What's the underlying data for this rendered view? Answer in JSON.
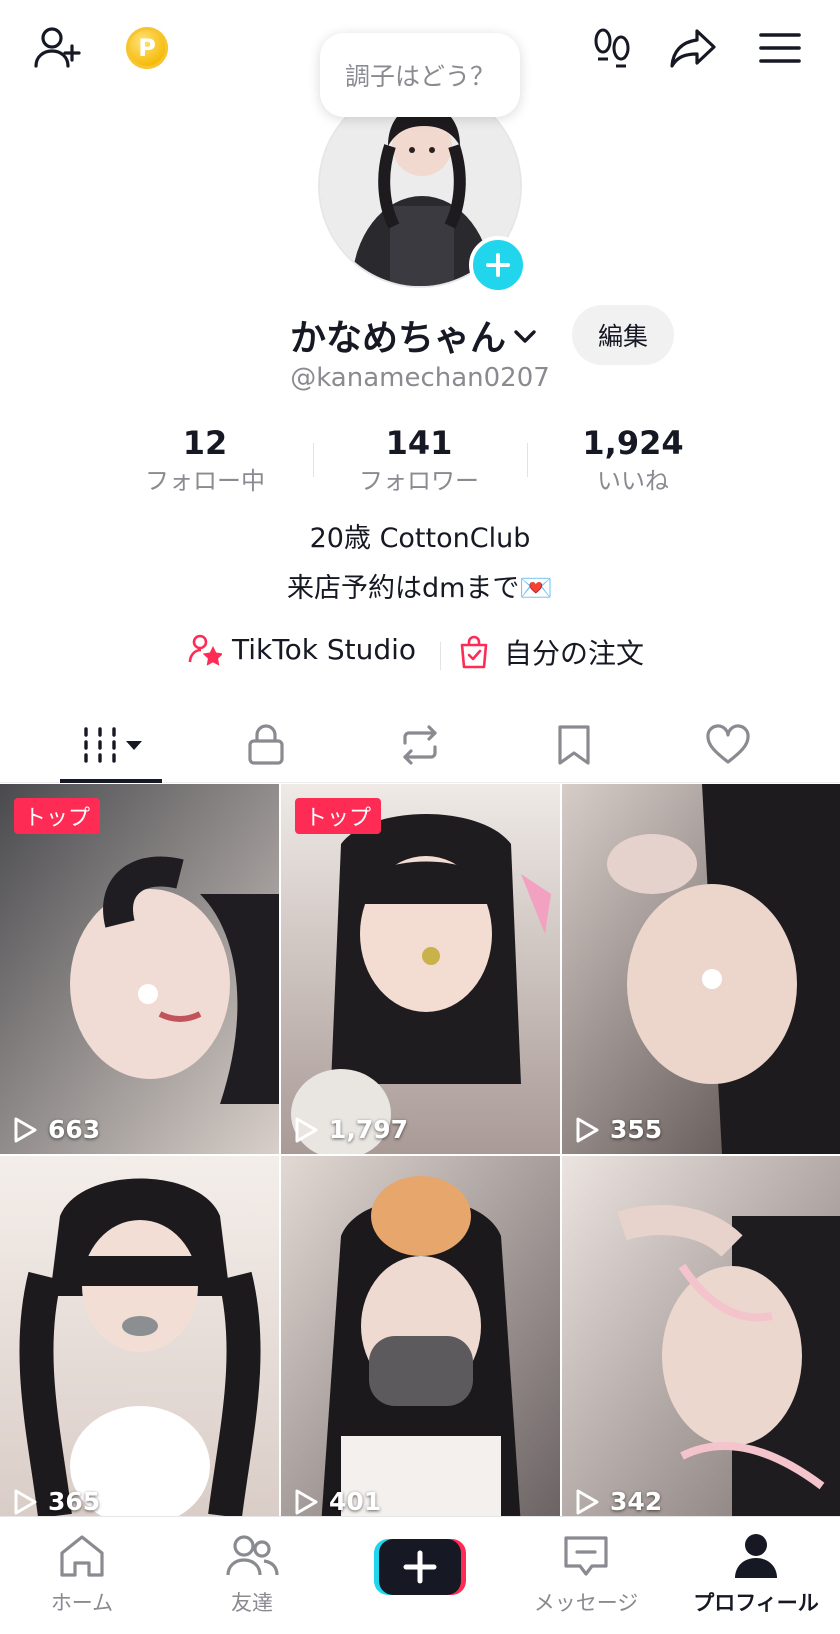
{
  "topbar": {
    "add_friend_icon": "person-plus-icon",
    "coin_icon": "coin-icon",
    "coin_letter": "P",
    "footprint_icon": "footprints-icon",
    "share_icon": "share-arrow-icon",
    "menu_icon": "hamburger-menu-icon"
  },
  "status_bubble": "調子はどう？",
  "profile": {
    "name": "かなめちゃん",
    "handle": "@kanamechan0207",
    "edit_label": "編集"
  },
  "stats": [
    {
      "value": "12",
      "label": "フォロー中"
    },
    {
      "value": "141",
      "label": "フォロワー"
    },
    {
      "value": "1,924",
      "label": "いいね"
    }
  ],
  "bio": {
    "line1": "20歳 CottonClub",
    "line2": "来店予約はdmまで💌"
  },
  "links": {
    "studio": "TikTok Studio",
    "orders": "自分の注文"
  },
  "tabs": [
    {
      "icon": "grid-videos-icon",
      "active": true
    },
    {
      "icon": "lock-icon"
    },
    {
      "icon": "repost-icon"
    },
    {
      "icon": "bookmark-icon"
    },
    {
      "icon": "heart-icon"
    }
  ],
  "videos": [
    {
      "views": "663",
      "badge": "トップ",
      "colors": [
        "#3a3a3c",
        "#d8cfc9"
      ]
    },
    {
      "views": "1,797",
      "badge": "トップ",
      "colors": [
        "#e9e3df",
        "#a99a96"
      ]
    },
    {
      "views": "355",
      "badge": "",
      "colors": [
        "#cfc2bd",
        "#5b4f4d"
      ]
    },
    {
      "views": "365",
      "badge": "",
      "colors": [
        "#f3ede9",
        "#b8aaa5"
      ]
    },
    {
      "views": "401",
      "badge": "",
      "colors": [
        "#ddd4cf",
        "#3c3637"
      ]
    },
    {
      "views": "342",
      "badge": "",
      "colors": [
        "#ebe3df",
        "#7a6f6d"
      ]
    }
  ],
  "bottom_nav": [
    {
      "label": "ホーム",
      "icon": "home-icon"
    },
    {
      "label": "友達",
      "icon": "friends-icon"
    },
    {
      "label": "",
      "icon": "create-plus-icon"
    },
    {
      "label": "メッセージ",
      "icon": "message-icon"
    },
    {
      "label": "プロフィール",
      "icon": "profile-icon",
      "active": true
    }
  ],
  "colors": {
    "accent_red": "#fe2c55",
    "accent_cyan": "#20d5ec",
    "text_primary": "#161823",
    "text_secondary": "#8a8b91"
  }
}
